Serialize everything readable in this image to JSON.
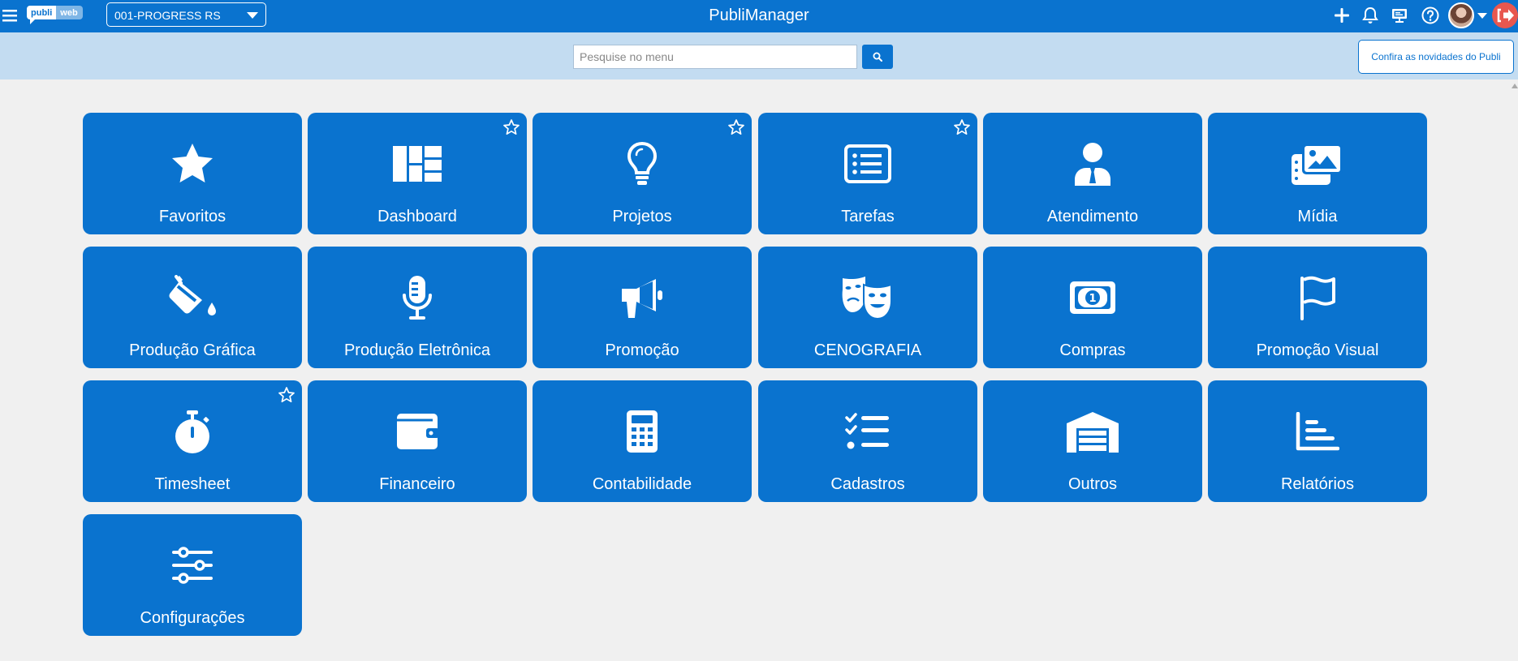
{
  "header": {
    "app_title": "PubliManager",
    "logo_part1": "publi",
    "logo_part2": "web",
    "company_select_value": "001-PROGRESS RS"
  },
  "search": {
    "placeholder": "Pesquise no menu",
    "news_button_label": "Confira as novidades do Publi"
  },
  "colors": {
    "primary": "#0a73cf",
    "search_band": "#c3dcf1",
    "background": "#f0f0f0",
    "logout": "#e8574f"
  },
  "modules": [
    {
      "label": "Favoritos",
      "icon": "star-icon",
      "favorite_toggle": false
    },
    {
      "label": "Dashboard",
      "icon": "dashboard-icon",
      "favorite_toggle": true
    },
    {
      "label": "Projetos",
      "icon": "lightbulb-icon",
      "favorite_toggle": true
    },
    {
      "label": "Tarefas",
      "icon": "list-icon",
      "favorite_toggle": true
    },
    {
      "label": "Atendimento",
      "icon": "user-tie-icon",
      "favorite_toggle": false
    },
    {
      "label": "Mídia",
      "icon": "images-icon",
      "favorite_toggle": false
    },
    {
      "label": "Produção Gráfica",
      "icon": "fill-drip-icon",
      "favorite_toggle": false
    },
    {
      "label": "Produção Eletrônica",
      "icon": "microphone-icon",
      "favorite_toggle": false
    },
    {
      "label": "Promoção",
      "icon": "megaphone-icon",
      "favorite_toggle": false
    },
    {
      "label": "CENOGRAFIA",
      "icon": "theater-masks-icon",
      "favorite_toggle": false
    },
    {
      "label": "Compras",
      "icon": "money-bill-icon",
      "favorite_toggle": false
    },
    {
      "label": "Promoção Visual",
      "icon": "flag-icon",
      "favorite_toggle": false
    },
    {
      "label": "Timesheet",
      "icon": "stopwatch-icon",
      "favorite_toggle": true
    },
    {
      "label": "Financeiro",
      "icon": "wallet-icon",
      "favorite_toggle": false
    },
    {
      "label": "Contabilidade",
      "icon": "calculator-icon",
      "favorite_toggle": false
    },
    {
      "label": "Cadastros",
      "icon": "tasks-icon",
      "favorite_toggle": false
    },
    {
      "label": "Outros",
      "icon": "warehouse-icon",
      "favorite_toggle": false
    },
    {
      "label": "Relatórios",
      "icon": "chart-bar-icon",
      "favorite_toggle": false
    },
    {
      "label": "Configurações",
      "icon": "sliders-icon",
      "favorite_toggle": false
    }
  ]
}
